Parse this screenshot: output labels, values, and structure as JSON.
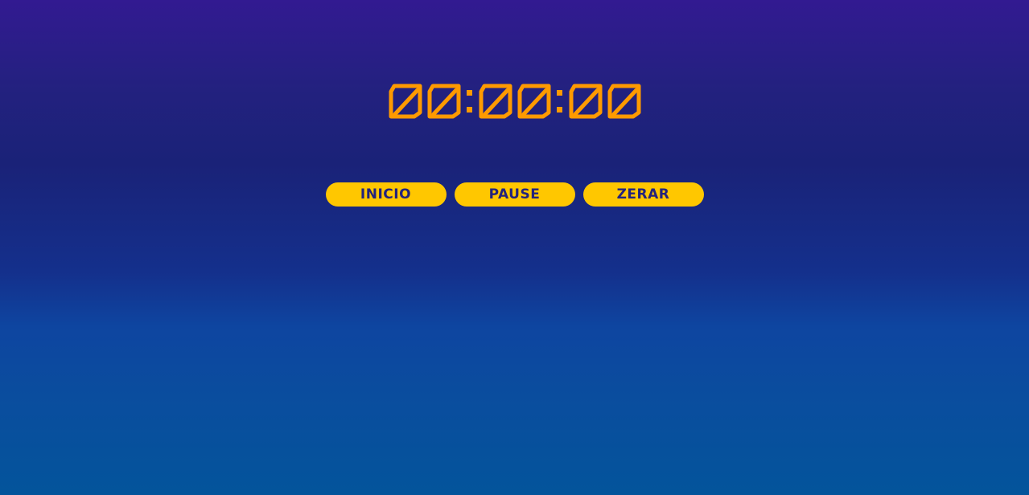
{
  "timer": {
    "display": "00:00:00",
    "hours": "00",
    "minutes": "00",
    "seconds": "00",
    "color": "#ff9a00"
  },
  "controls": {
    "start_label": "INICIO",
    "pause_label": "PAUSE",
    "reset_label": "ZERAR",
    "button_color": "#ffc700",
    "button_text_color": "#23237d"
  },
  "background": {
    "top_color": "#321a91",
    "bottom_color": "#03549b"
  }
}
